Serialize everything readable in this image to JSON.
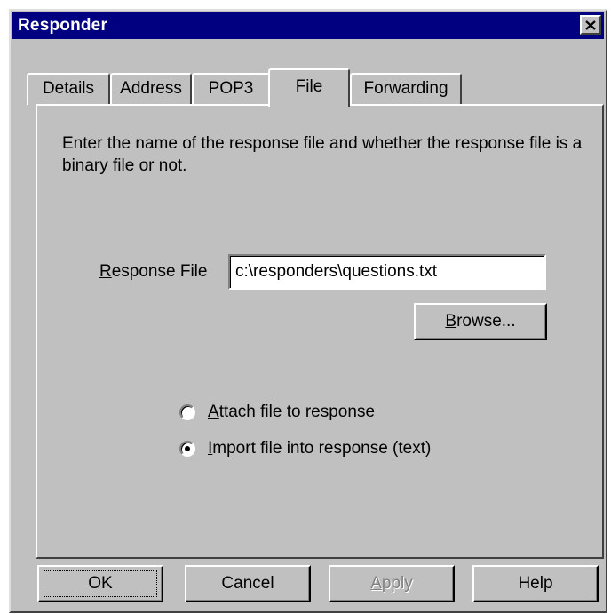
{
  "window": {
    "title": "Responder",
    "close_glyph": "✕"
  },
  "tabs": [
    {
      "label": "Details",
      "active": false
    },
    {
      "label": "Address",
      "active": false
    },
    {
      "label": "POP3",
      "active": false
    },
    {
      "label": "File",
      "active": true
    },
    {
      "label": "Forwarding",
      "active": false
    }
  ],
  "panel": {
    "description": "Enter the name of the response file and whether the response file is a binary file or not.",
    "response_file": {
      "label_first": "R",
      "label_rest": "esponse File",
      "value": "c:\\responders\\questions.txt"
    },
    "browse_button": {
      "first": "B",
      "rest": "rowse..."
    },
    "options": [
      {
        "first": "A",
        "rest": "ttach file to response",
        "selected": false
      },
      {
        "first": "I",
        "rest": "mport file into response (text)",
        "selected": true
      }
    ]
  },
  "buttons": {
    "ok": "OK",
    "cancel": "Cancel",
    "apply_first": "A",
    "apply_rest": "pply",
    "help": "Help"
  },
  "colors": {
    "title_bar": "#000080",
    "face": "#c0c0c0",
    "disabled_text": "#808080"
  },
  "icons": {
    "close": "close-icon"
  }
}
